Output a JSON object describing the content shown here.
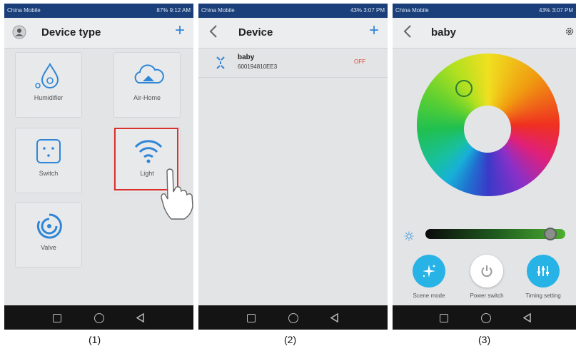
{
  "screen1": {
    "carrier": "China Mobile",
    "status_right": "87% 9:12 AM",
    "title": "Device type",
    "tiles": [
      {
        "label": "Humidifier"
      },
      {
        "label": "Air-Home"
      },
      {
        "label": "Switch"
      },
      {
        "label": "Light"
      },
      {
        "label": "Valve"
      }
    ],
    "caption": "(1)"
  },
  "screen2": {
    "carrier": "China Mobile",
    "status_right": "43% 3:07 PM",
    "title": "Device",
    "device": {
      "name": "baby",
      "id": "600194810EE3",
      "state": "OFF"
    },
    "caption": "(2)"
  },
  "screen3": {
    "carrier": "China Mobile",
    "status_right": "43% 3:07 PM",
    "title": "baby",
    "brightness": 0.93,
    "buttons": [
      {
        "label": "Scene mode"
      },
      {
        "label": "Power switch"
      },
      {
        "label": "Timing setting"
      }
    ],
    "caption": "(3)"
  },
  "colors": {
    "accent": "#2f86d6",
    "status_bar": "#1a3f7a",
    "off_text": "#e0452f",
    "highlight_box": "#d9312c",
    "button_cyan": "#27b3e6"
  }
}
